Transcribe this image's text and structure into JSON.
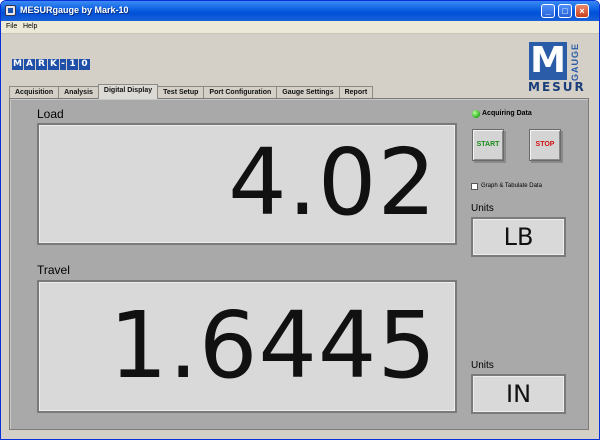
{
  "window": {
    "title": "MESURgauge by Mark-10",
    "controls": {
      "minimize": "_",
      "maximize": "□",
      "close": "×"
    }
  },
  "menu": [
    "File",
    "Help"
  ],
  "logos": {
    "brand_letters": [
      "M",
      "A",
      "R",
      "K",
      "-",
      "1",
      "0"
    ],
    "product_letter": "M",
    "product_side": "GAUGE",
    "product_bottom": "MESUR"
  },
  "tabs": [
    {
      "label": "Acquisition",
      "active": false
    },
    {
      "label": "Analysis",
      "active": false
    },
    {
      "label": "Digital Display",
      "active": true
    },
    {
      "label": "Test Setup",
      "active": false
    },
    {
      "label": "Port Configuration",
      "active": false
    },
    {
      "label": "Gauge Settings",
      "active": false
    },
    {
      "label": "Report",
      "active": false
    }
  ],
  "load": {
    "label": "Load",
    "value": "4.02",
    "units_label": "Units",
    "units": "LB"
  },
  "travel": {
    "label": "Travel",
    "value": "1.6445",
    "units_label": "Units",
    "units": "IN"
  },
  "status": {
    "acquiring_label": "Acquiring Data",
    "led_color": "#28b018"
  },
  "buttons": {
    "start": {
      "label": "START",
      "color": "#1a8a1a"
    },
    "stop": {
      "label": "STOP",
      "color": "#d01010"
    }
  },
  "graph_tabulate": {
    "label": "Graph & Tabulate Data",
    "checked": false
  }
}
